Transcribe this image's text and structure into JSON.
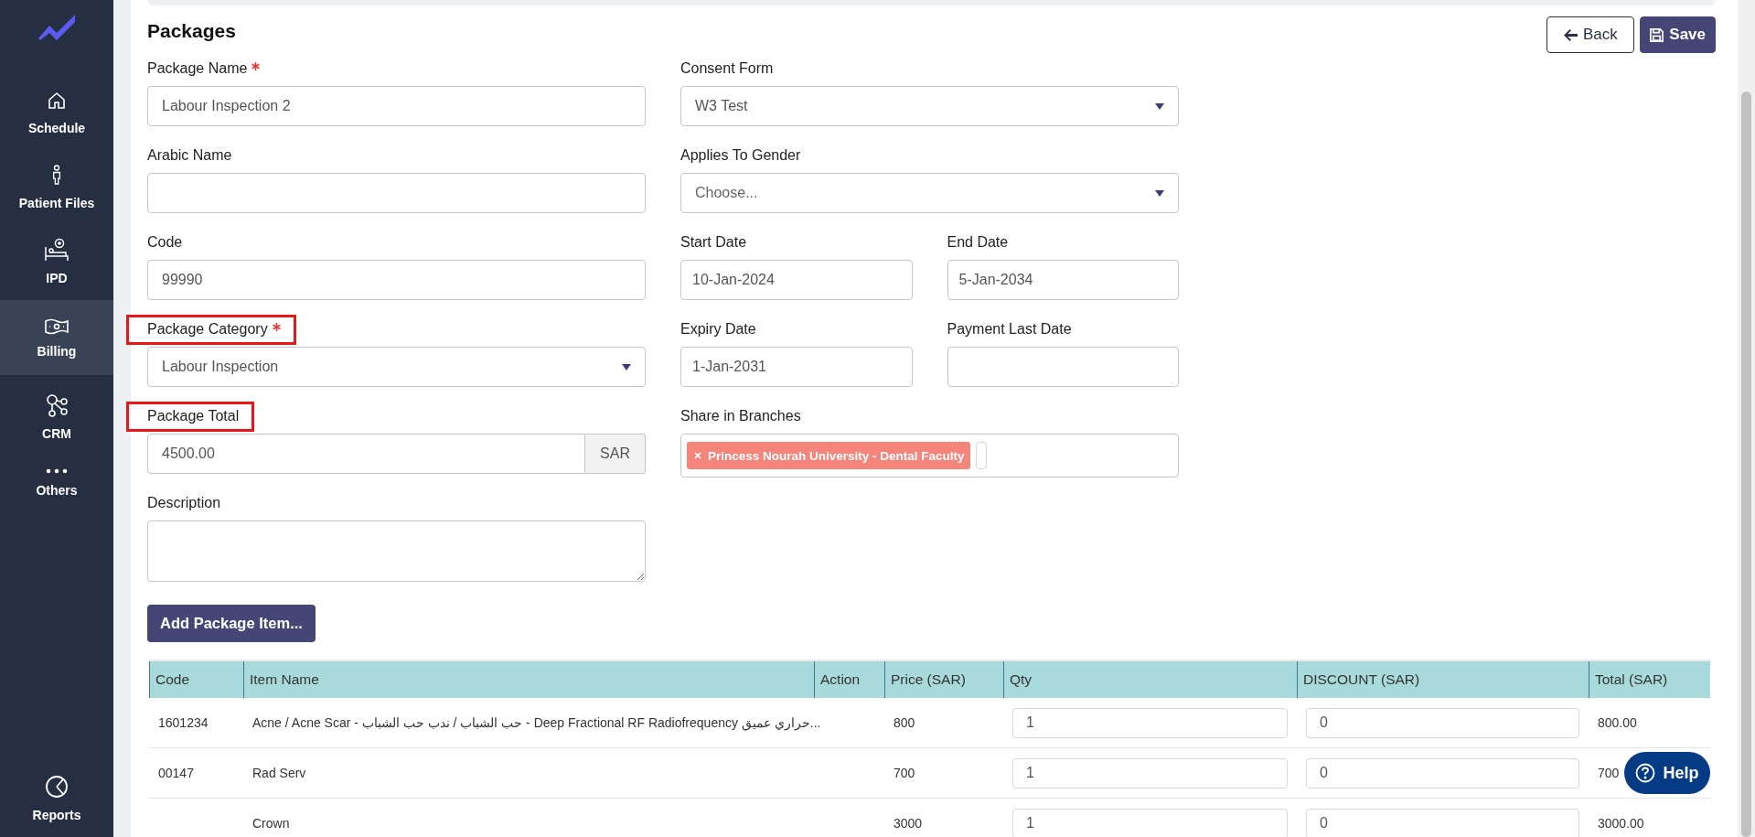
{
  "sidebar": {
    "items": [
      {
        "label": "Schedule",
        "kind": "home",
        "selected": false
      },
      {
        "label": "Patient Files",
        "kind": "person",
        "selected": false
      },
      {
        "label": "IPD",
        "kind": "bed",
        "selected": false
      },
      {
        "label": "Billing",
        "kind": "money",
        "selected": true
      },
      {
        "label": "CRM",
        "kind": "nodes",
        "selected": false
      },
      {
        "label": "Others",
        "kind": "dots",
        "selected": false
      }
    ],
    "footer": {
      "label": "Reports",
      "kind": "chart"
    }
  },
  "page": {
    "title": "Packages"
  },
  "actions": [
    {
      "label": "Back",
      "kind": "back"
    },
    {
      "label": "Save",
      "kind": "save"
    }
  ],
  "left_fields": [
    {
      "label": "Package Name",
      "required": true,
      "highlighted": false,
      "kind": "text",
      "value": "Labour Inspection 2"
    },
    {
      "label": "Arabic Name",
      "required": false,
      "highlighted": false,
      "kind": "text"
    },
    {
      "label": "Code",
      "required": false,
      "highlighted": false,
      "kind": "text",
      "value": "99990"
    },
    {
      "label": "Package Category",
      "required": true,
      "highlighted": true,
      "kind": "select",
      "value": "Labour Inspection"
    },
    {
      "label": "Package Total",
      "required": false,
      "highlighted": true,
      "kind": "addon",
      "value": "4500.00",
      "addon": "SAR"
    },
    {
      "label": "Description",
      "required": false,
      "highlighted": false,
      "kind": "textarea"
    }
  ],
  "right_rows": [
    [
      {
        "label": "Consent Form",
        "kind": "select",
        "value": "W3 Test"
      }
    ],
    [
      {
        "label": "Applies To Gender",
        "kind": "select",
        "placeholder": "Choose..."
      }
    ],
    [
      {
        "label": "Start Date",
        "kind": "date",
        "value": "10-Jan-2024"
      },
      {
        "label": "End Date",
        "kind": "date",
        "value": "5-Jan-2034"
      }
    ],
    [
      {
        "label": "Expiry Date",
        "kind": "date",
        "value": "1-Jan-2031"
      },
      {
        "label": "Payment Last Date",
        "kind": "date"
      }
    ],
    [
      {
        "label": "Share in Branches",
        "kind": "tags",
        "tags": [
          "Princess Nourah University - Dental Faculty"
        ]
      }
    ]
  ],
  "add_button": "Add Package Item...",
  "table": {
    "columns": [
      "Code",
      "Item Name",
      "Action",
      "Price (SAR)",
      "Qty",
      "DISCOUNT (SAR)",
      "Total (SAR)"
    ],
    "rows": [
      {
        "code": "1601234",
        "item_name": "Acne / Acne Scar - حب الشباب / ندب حب الشباب - Deep Fractional RF Radiofrequency حراري عميق...",
        "price": "800",
        "qty": "1",
        "discount": "0",
        "total": "800.00"
      },
      {
        "code": "00147",
        "item_name": "Rad Serv",
        "price": "700",
        "qty": "1",
        "discount": "0",
        "total": "700"
      },
      {
        "item_name": "Crown",
        "price": "3000",
        "qty": "1",
        "discount": "0",
        "total": "3000.00"
      }
    ]
  },
  "help_button": "Help"
}
